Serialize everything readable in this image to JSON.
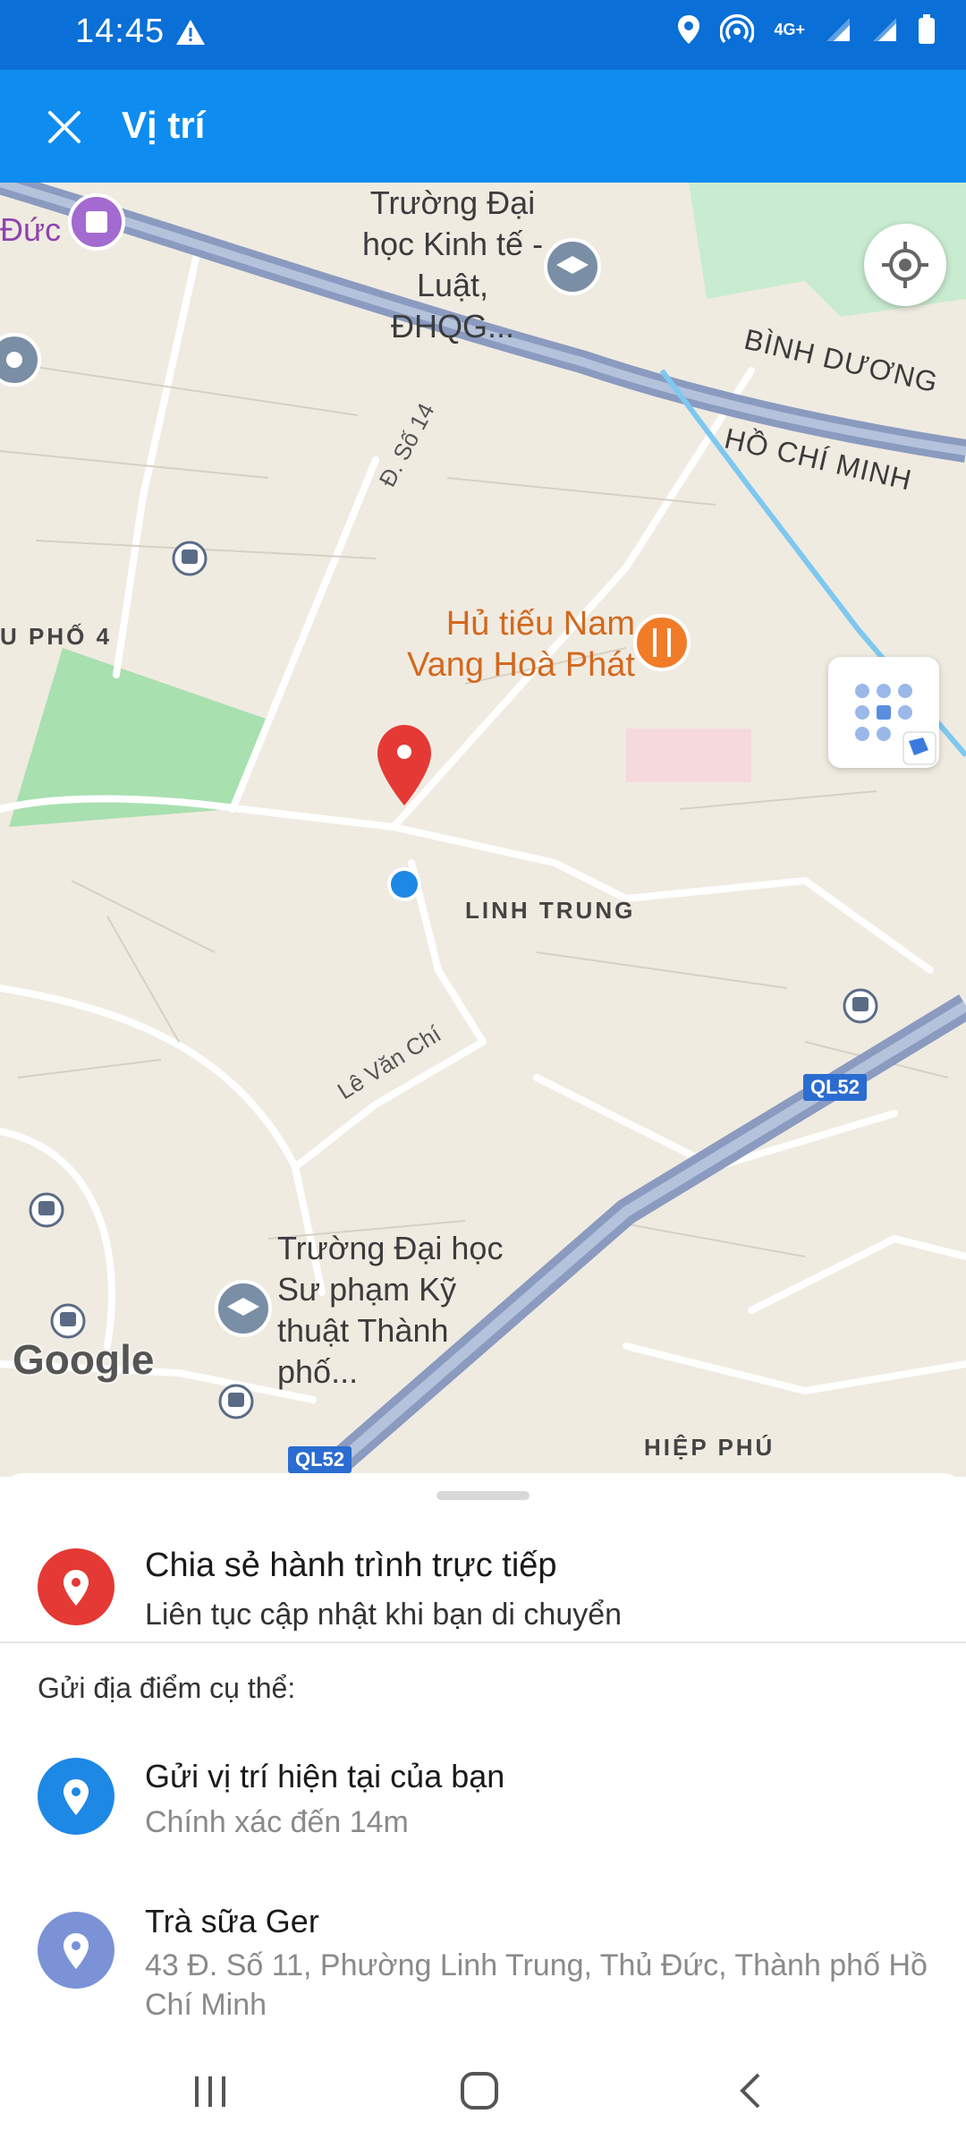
{
  "status_bar": {
    "time": "14:45",
    "network": "4G+",
    "icons": [
      "warning-icon",
      "location-icon",
      "hotspot-icon",
      "signal-icon",
      "signal-icon",
      "battery-icon"
    ]
  },
  "app_bar": {
    "title": "Vị trí",
    "close_icon": "close-icon"
  },
  "map": {
    "labels": {
      "poi_dhkt": "Trường Đại học Kinh tế - Luật, ĐHQG...",
      "poi_food": "Hủ tiếu Nam Vang Hoà Phát",
      "poi_dhsp": "Trường Đại học Sư phạm Kỹ thuật Thành phố...",
      "region_bd": "BÌNH DƯƠNG",
      "region_hcm": "HỒ CHÍ MINH",
      "street_so14": "Đ. Số 14",
      "street_lvc": "Lê Văn Chí",
      "district_linhtrung": "LINH TRUNG",
      "district_hiepphu": "HIỆP PHÚ",
      "area_uphong4": "U PHỐ 4",
      "area_duc": "Đức",
      "route_ql52_a": "QL52",
      "route_ql52_b": "QL52",
      "google": "Google"
    },
    "colors": {
      "background": "#f0ebe1",
      "road": "#ffffff",
      "highway": "#8a9bbf",
      "pin": "#e53935",
      "location_dot": "#1e88e5",
      "park": "#a8e0b0"
    }
  },
  "sheet": {
    "live_share": {
      "title": "Chia sẻ hành trình trực tiếp",
      "subtitle": "Liên tục cập nhật khi bạn di chuyển"
    },
    "section_label": "Gửi địa điểm cụ thể:",
    "current_location": {
      "title": "Gửi vị trí hiện tại của bạn",
      "subtitle": "Chính xác đến 14m"
    },
    "place": {
      "title": "Trà sữa Ger",
      "subtitle": "43 Đ. Số 11, Phường Linh Trung, Thủ Đức, Thành phố Hồ Chí Minh"
    }
  },
  "nav_bar": {
    "icons": [
      "recent-apps-icon",
      "home-icon",
      "back-icon"
    ]
  }
}
